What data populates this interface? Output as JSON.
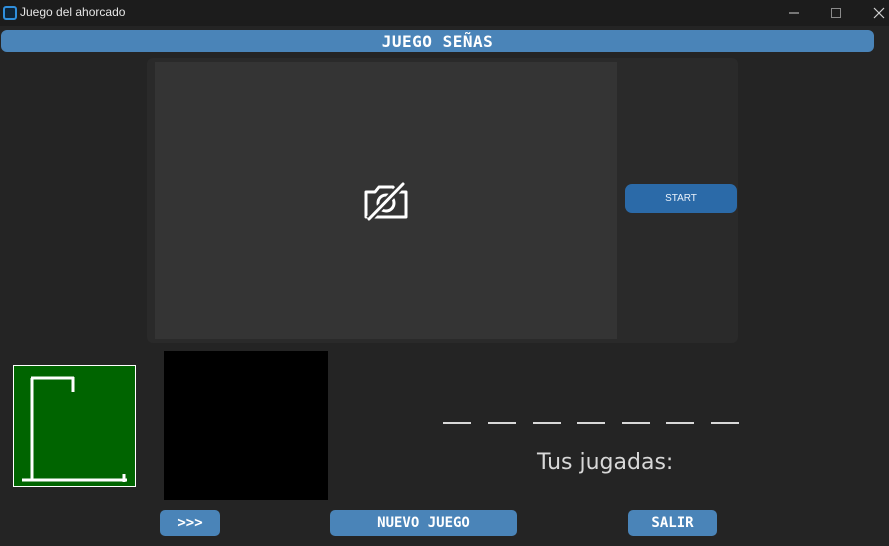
{
  "window": {
    "title": "Juego del ahorcado",
    "controls": [
      "minimize",
      "maximize",
      "close"
    ]
  },
  "header": {
    "title": "JUEGO SEÑAS"
  },
  "camera": {
    "icon": "camera-off-icon",
    "start_label": "START"
  },
  "game": {
    "word_slots": [
      "",
      "",
      "",
      "",
      "",
      "",
      ""
    ],
    "plays_label": "Tus jugadas:"
  },
  "buttons": {
    "next_label": ">>>",
    "new_game_label": "NUEVO JUEGO",
    "exit_label": "SALIR"
  },
  "colors": {
    "accent": "#4a84b8",
    "start_button": "#2b6aa8",
    "hangman_bg": "#006400",
    "background": "#242424"
  }
}
